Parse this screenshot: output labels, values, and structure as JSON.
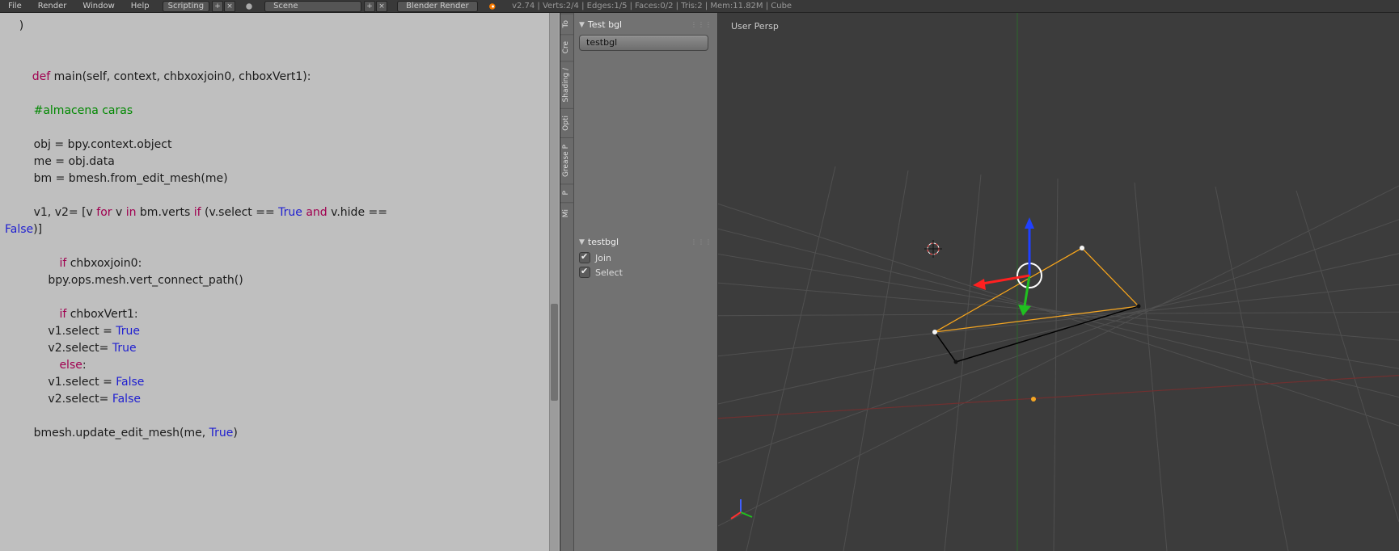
{
  "topbar": {
    "menus": [
      "File",
      "Render",
      "Window",
      "Help"
    ],
    "layout": "Scripting",
    "scene": "Scene",
    "engine": "Blender Render",
    "stats": "v2.74 | Verts:2/4 | Edges:1/5 | Faces:0/2 | Tris:2 | Mem:11.82M | Cube"
  },
  "code": {
    "l1": "    )",
    "l3_def": "def",
    "l3_rest": " main(self, context, chbxoxjoin0, chboxVert1):",
    "l5_comment": "        #almacena caras",
    "l7": "        obj = bpy.context.object",
    "l8": "        me = obj.data",
    "l9": "        bm = bmesh.from_edit_mesh(me)",
    "l11a": "        v1, v2= [v ",
    "l11_for": "for",
    "l11b": " v ",
    "l11_in": "in",
    "l11c": " bm.verts ",
    "l11_if": "if",
    "l11d": " (v.select == ",
    "l11_true": "True",
    "l11_and": " and ",
    "l11e": "v.hide == ",
    "l12_false": "False",
    "l12b": ")]",
    "l14_if": "if",
    "l14b": " chbxoxjoin0:",
    "l15": "            bpy.ops.mesh.vert_connect_path()",
    "l17_if": "if",
    "l17b": " chboxVert1:",
    "l18a": "            v1.select = ",
    "l18_true": "True",
    "l19a": "            v2.select= ",
    "l19_true": "True",
    "l20_else": "else",
    "l20b": ":",
    "l21a": "            v1.select = ",
    "l21_false": "False",
    "l22a": "            v2.select= ",
    "l22_false": "False",
    "l24a": "        bmesh.update_edit_mesh(me, ",
    "l24_true": "True",
    "l24b": ")"
  },
  "vtabs": [
    "To",
    "Cre",
    "Shading /",
    "Opti",
    "Grease P",
    "P",
    "Mi"
  ],
  "tool_panel": {
    "header": "Test bgl",
    "button": "testbgl",
    "redo_header": "testbgl",
    "check1": "Join",
    "check2": "Select"
  },
  "viewport": {
    "label": "User Persp"
  }
}
